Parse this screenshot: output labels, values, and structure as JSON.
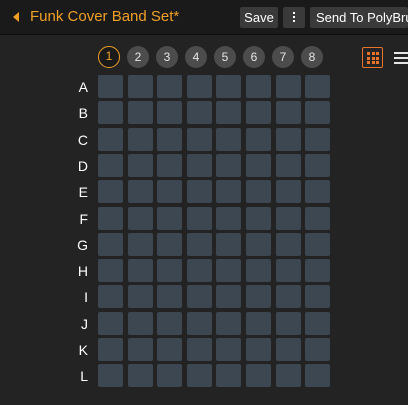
{
  "header": {
    "title": "Funk Cover Band Set*",
    "save_label": "Save",
    "send_label": "Send To PolyBrute"
  },
  "banks": [
    "1",
    "2",
    "3",
    "4",
    "5",
    "6",
    "7",
    "8"
  ],
  "active_bank": "1",
  "rows": [
    "A",
    "B",
    "C",
    "D",
    "E",
    "F",
    "G",
    "H",
    "I",
    "J",
    "K",
    "L"
  ],
  "view": {
    "active": "grid"
  },
  "colors": {
    "accent": "#f0a026",
    "view_accent": "#e8742a",
    "cell": "#3c4752",
    "background": "#232323"
  }
}
